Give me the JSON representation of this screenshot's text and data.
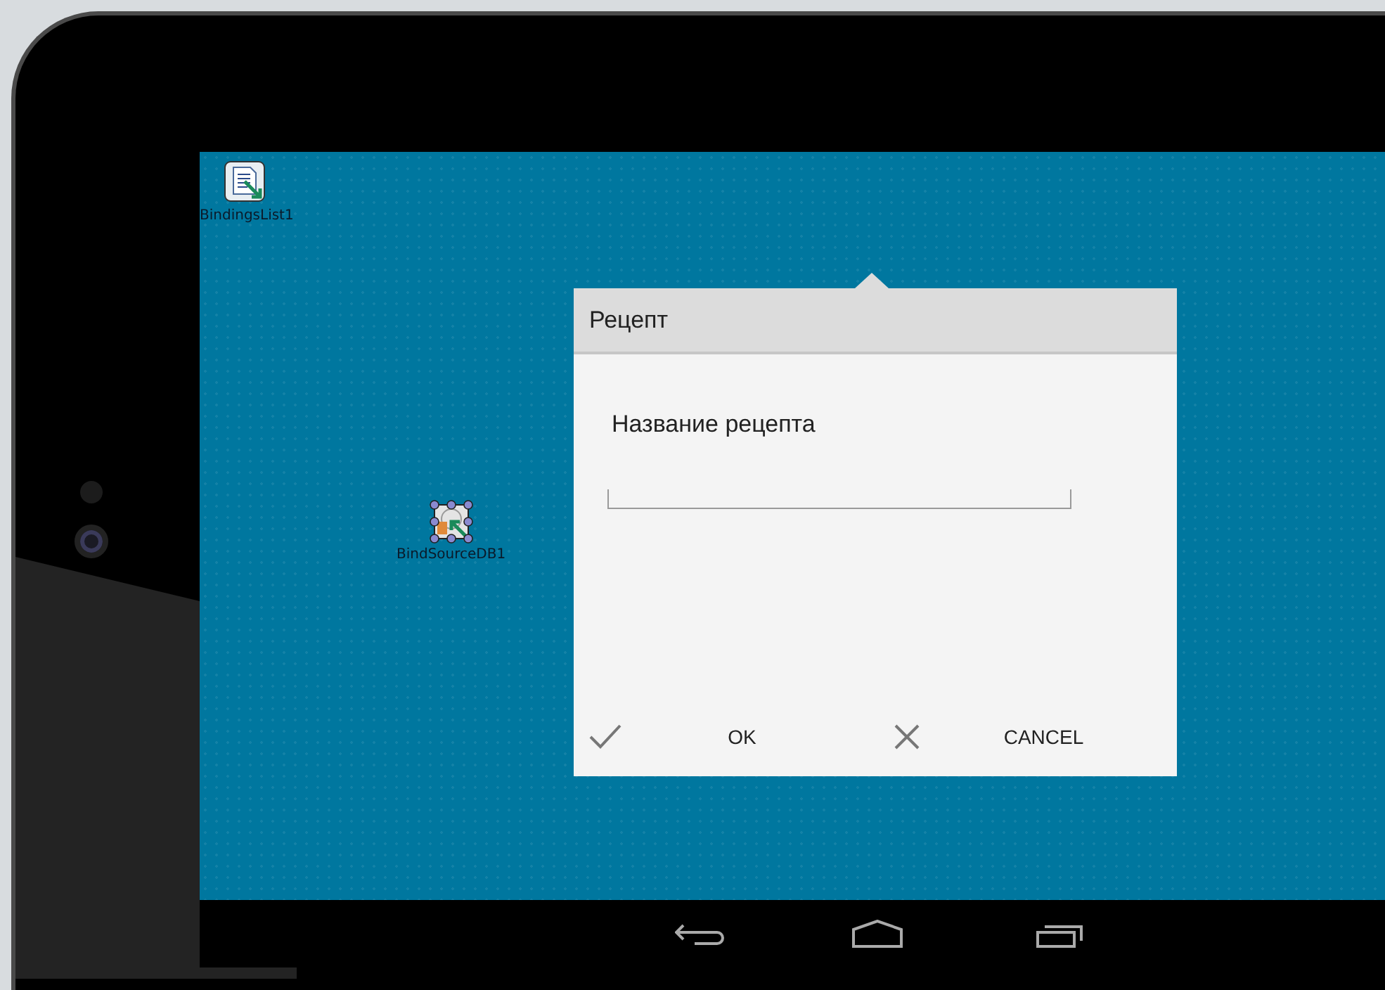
{
  "components": [
    {
      "label": "BindingsList1",
      "kind": "list",
      "selected": false
    },
    {
      "label": "BindSourceDB1",
      "kind": "source",
      "selected": true
    }
  ],
  "dialog": {
    "title": "Рецепт",
    "field_label": "Название рецепта",
    "buttons": [
      {
        "kind": "ok",
        "label": "OK"
      },
      {
        "kind": "cancel",
        "label": "CANCEL"
      }
    ]
  }
}
